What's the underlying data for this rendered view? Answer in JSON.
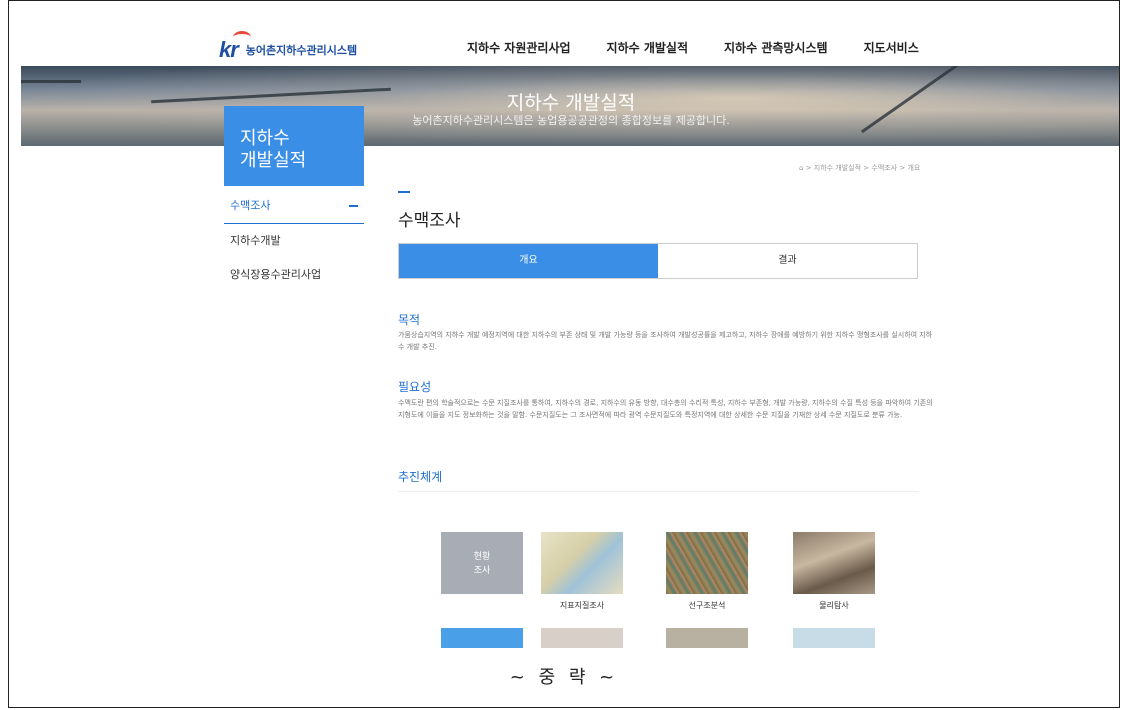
{
  "header": {
    "logo_mark": "kr",
    "logo_text": "농어촌지하수관리시스템",
    "nav": [
      "지하수 자원관리사업",
      "지하수 개발실적",
      "지하수 관측망시스템",
      "지도서비스"
    ]
  },
  "hero": {
    "title": "지하수 개발실적",
    "subtitle": "농어촌지하수관리시스템은 농업용공공관정의 종합정보를 제공합니다."
  },
  "sidebar": {
    "title_line1": "지하수",
    "title_line2": "개발실적",
    "items": [
      {
        "label": "수맥조사",
        "active": true
      },
      {
        "label": "지하수개발",
        "active": false
      },
      {
        "label": "양식장용수관리사업",
        "active": false
      }
    ]
  },
  "breadcrumb": "⌂ > 지하수 개발실적 > 수맥조사 > 개요",
  "page_title": "수맥조사",
  "tabs": [
    {
      "label": "개요",
      "active": true
    },
    {
      "label": "결과",
      "active": false
    }
  ],
  "sections": {
    "purpose": {
      "title": "목적",
      "body": "가뭄상습지역의 지하수 개발 예정지역에 대한 지하수의 부존 상태 및 개발 가능량 등을 조사하여 개발성공률을 제고하고, 지하수 장애를 예방하기 위한 지하수 맹형조사를 실시하여 지하수 개발 추진."
    },
    "necessity": {
      "title": "필요성",
      "body": "수맥도란 편의 학술적으로는 수문 지질조사를 통하여, 지하수의 경로, 지하수의 유동 방향, 대수층의 수리적 특성, 지하수 부존형, 개발 가능량, 지하수의 수질 특성 등을 파악하여 기존의 지형도에 이들을 지도 정보화하는 것을 말함. 수문지질도는 그 조사면적에 따라 광역 수문지질도와 특정지역에 대한 상세한 수문 지질을 기재한 상세 수문 지질도로 분류 가능."
    },
    "process": {
      "title": "추진체계"
    }
  },
  "gallery": [
    {
      "label": "현황\n조사",
      "caption": ""
    },
    {
      "label": "",
      "caption": "지표지질조사"
    },
    {
      "label": "",
      "caption": "선구조분석"
    },
    {
      "label": "",
      "caption": "물리탐사"
    }
  ],
  "gallery_labels": {
    "first_line1": "현황",
    "first_line2": "조사"
  },
  "omission_note": "~ 중  략 ~"
}
